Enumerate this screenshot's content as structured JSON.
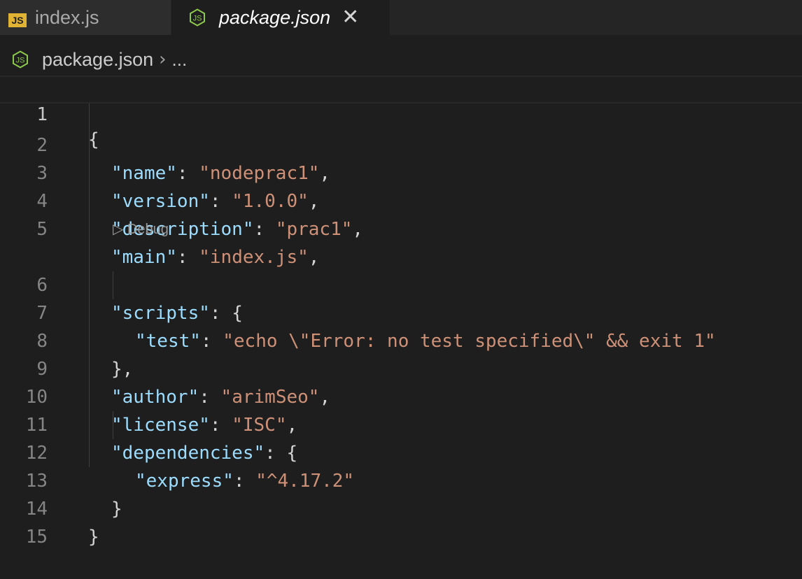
{
  "tabs": [
    {
      "icon": "js-file-icon",
      "badge": "JS",
      "label": "index.js",
      "active": false
    },
    {
      "icon": "nodejs-icon",
      "label": "package.json",
      "active": true,
      "close": "✕"
    }
  ],
  "breadcrumb": {
    "file": "package.json",
    "separator": "›",
    "more": "..."
  },
  "codelens": {
    "label": "▷ Debug"
  },
  "lines": [
    {
      "n": "1"
    },
    {
      "n": "2",
      "key": "\"name\"",
      "colon": ": ",
      "val": "\"nodeprac1\"",
      "end": ","
    },
    {
      "n": "3",
      "key": "\"version\"",
      "colon": ": ",
      "val": "\"1.0.0\"",
      "end": ","
    },
    {
      "n": "4",
      "key": "\"description\"",
      "colon": ": ",
      "val": "\"prac1\"",
      "end": ","
    },
    {
      "n": "5",
      "key": "\"main\"",
      "colon": ": ",
      "val": "\"index.js\"",
      "end": ","
    },
    {
      "n": "6",
      "key": "\"scripts\"",
      "colon": ": ",
      "end": "{"
    },
    {
      "n": "7",
      "key": "\"test\"",
      "colon": ": ",
      "val": "\"echo \\\"Error: no test specified\\\" && exit 1\""
    },
    {
      "n": "8",
      "text": "},"
    },
    {
      "n": "9",
      "key": "\"author\"",
      "colon": ": ",
      "val": "\"arimSeo\"",
      "end": ","
    },
    {
      "n": "10",
      "key": "\"license\"",
      "colon": ": ",
      "val": "\"ISC\"",
      "end": ","
    },
    {
      "n": "11",
      "key": "\"dependencies\"",
      "colon": ": ",
      "end": "{"
    },
    {
      "n": "12",
      "key": "\"express\"",
      "colon": ": ",
      "val": "\"^4.17.2\""
    },
    {
      "n": "13",
      "text": "}"
    },
    {
      "n": "14",
      "text": "}"
    },
    {
      "n": "15"
    }
  ],
  "open_brace": "{",
  "colors": {
    "key": "#9cdcfe",
    "string": "#ce9178",
    "punct": "#d4d4d4",
    "background": "#1e1e1e"
  }
}
